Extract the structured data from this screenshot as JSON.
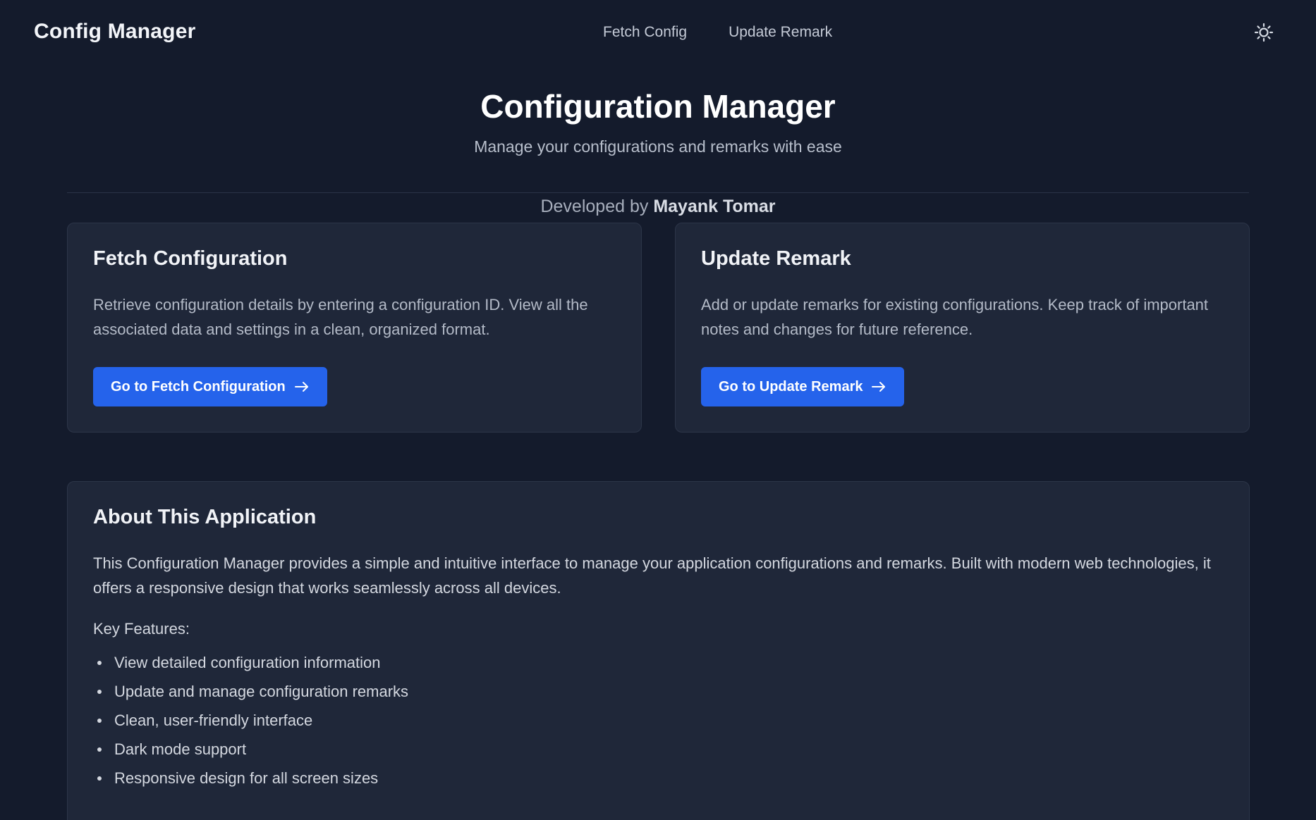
{
  "header": {
    "brand": "Config Manager",
    "nav": [
      {
        "label": "Fetch Config"
      },
      {
        "label": "Update Remark"
      }
    ],
    "theme_icon": "sun-icon"
  },
  "hero": {
    "title": "Configuration Manager",
    "subtitle": "Manage your configurations and remarks with ease",
    "developed_prefix": "Developed by",
    "developer": "Mayank Tomar"
  },
  "cards": {
    "fetch": {
      "title": "Fetch Configuration",
      "description": "Retrieve configuration details by entering a configuration ID. View all the associated data and settings in a clean, organized format.",
      "button": "Go to Fetch Configuration",
      "button_icon": "arrow-right-icon"
    },
    "update": {
      "title": "Update Remark",
      "description": "Add or update remarks for existing configurations. Keep track of important notes and changes for future reference.",
      "button": "Go to Update Remark",
      "button_icon": "arrow-right-icon"
    }
  },
  "about": {
    "title": "About This Application",
    "text": "This Configuration Manager provides a simple and intuitive interface to manage your application configurations and remarks. Built with modern web technologies, it offers a responsive design that works seamlessly across all devices.",
    "features_title": "Key Features:",
    "features": [
      "View detailed configuration information",
      "Update and manage configuration remarks",
      "Clean, user-friendly interface",
      "Dark mode support",
      "Responsive design for all screen sizes"
    ]
  },
  "colors": {
    "background": "#141b2c",
    "card": "#1f2739",
    "accent": "#2563eb"
  }
}
